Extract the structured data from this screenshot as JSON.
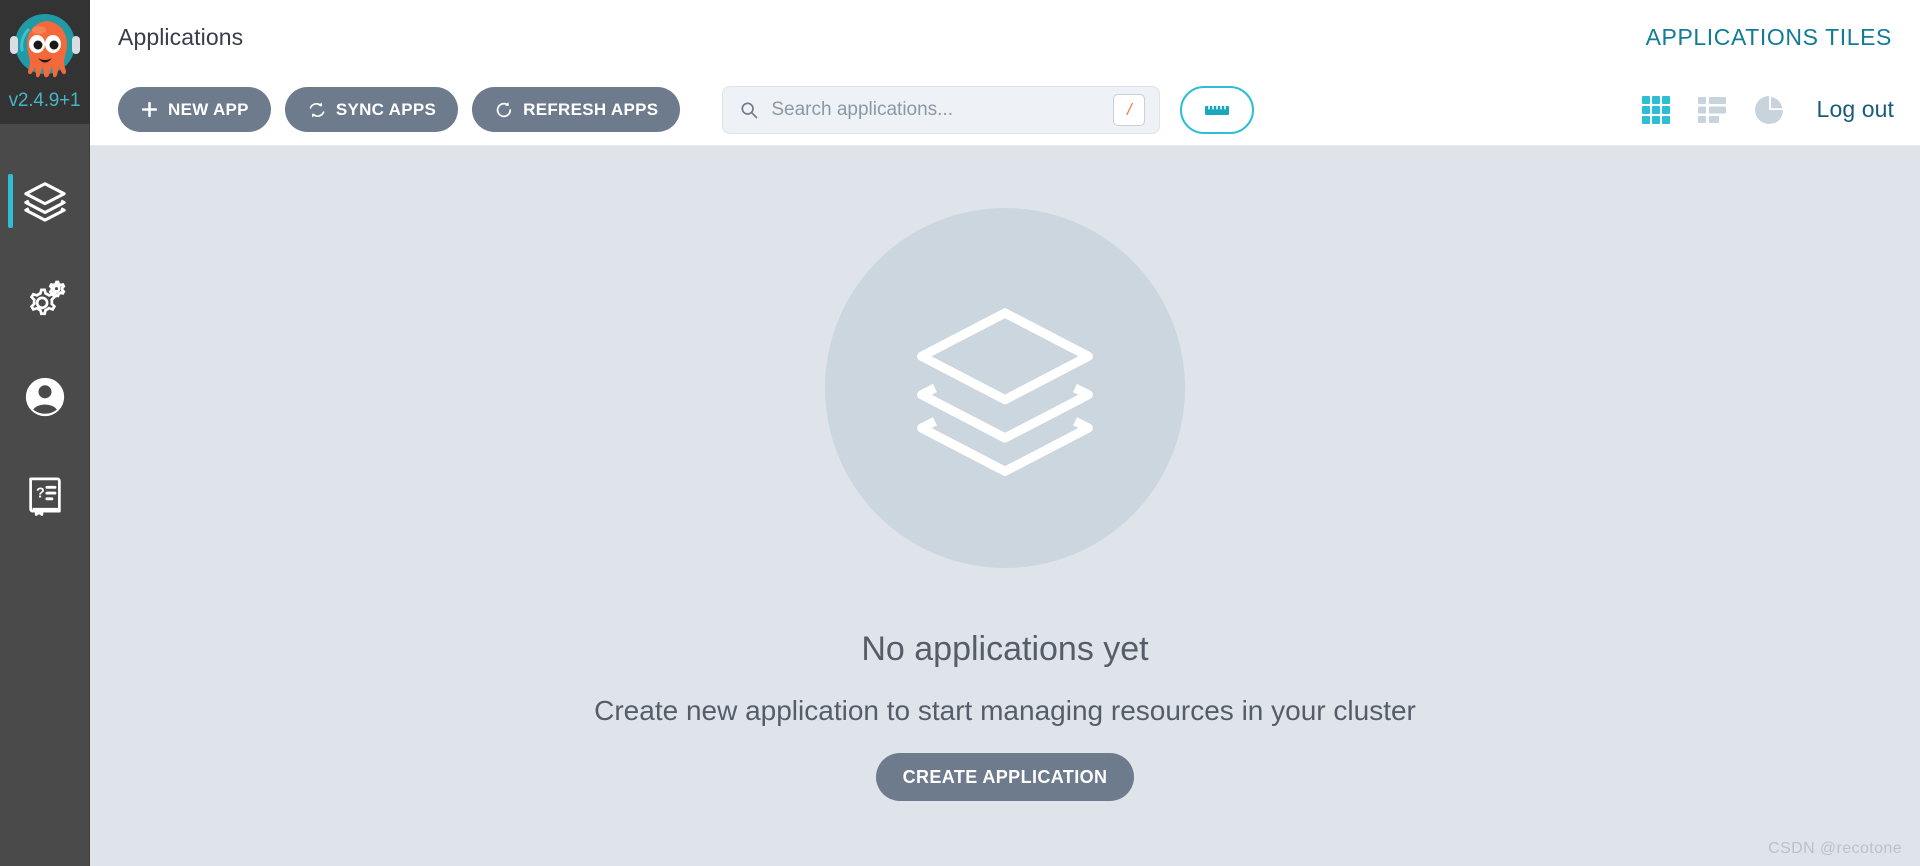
{
  "sidebar": {
    "version": "v2.4.9+1",
    "logo_alt": "argo-cd-octopus-logo",
    "items": [
      {
        "name": "applications",
        "icon": "layers-icon",
        "active": true
      },
      {
        "name": "settings",
        "icon": "gear-icon",
        "active": false
      },
      {
        "name": "user-info",
        "icon": "user-icon",
        "active": false
      },
      {
        "name": "documentation",
        "icon": "book-help-icon",
        "active": false
      }
    ]
  },
  "header": {
    "title": "Applications",
    "view_label": "APPLICATIONS TILES"
  },
  "toolbar": {
    "new_app_label": "NEW APP",
    "sync_apps_label": "SYNC APPS",
    "refresh_apps_label": "REFRESH APPS",
    "search": {
      "placeholder": "Search applications...",
      "value": "",
      "shortcut_key": "/"
    },
    "filter_button": "filter-ruler-icon",
    "views": [
      {
        "name": "tiles",
        "icon": "grid-tiles-icon",
        "active": true
      },
      {
        "name": "list",
        "icon": "list-view-icon",
        "active": false
      },
      {
        "name": "summary",
        "icon": "pie-chart-icon",
        "active": false
      }
    ],
    "logout_label": "Log out"
  },
  "empty_state": {
    "icon": "layers-icon",
    "title": "No applications yet",
    "subtitle": "Create new application to start managing resources in your cluster",
    "button_label": "CREATE APPLICATION"
  },
  "watermark": "CSDN @recotone",
  "colors": {
    "accent_cyan": "#2dbdd4",
    "brand_teal": "#127b98",
    "button_slate": "#6d7b8d",
    "sidebar_dark": "#4a4a4a",
    "page_bg": "#dee4ea",
    "logo_orange": "#f4683a"
  }
}
